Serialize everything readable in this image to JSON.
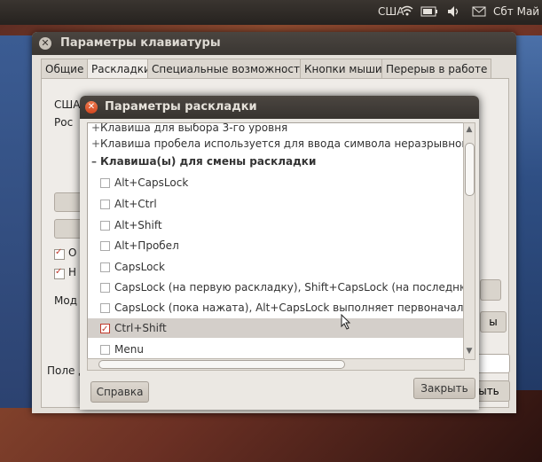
{
  "panel": {
    "layout_indicator": "США",
    "datetime": "Сбт Май",
    "icons": [
      "wifi-icon",
      "battery-icon",
      "volume-icon",
      "mail-icon"
    ]
  },
  "main_window": {
    "title": "Параметры клавиатуры",
    "tabs": [
      {
        "label": "Общие",
        "active": false
      },
      {
        "label": "Раскладки",
        "active": true
      },
      {
        "label": "Специальные возможности",
        "active": false
      },
      {
        "label": "Кнопки мыши",
        "active": false
      },
      {
        "label": "Перерыв в работе",
        "active": false
      }
    ],
    "partial": {
      "list_line1": "США",
      "list_line2": "Рос",
      "check1": "О",
      "check2": "Н",
      "model_label": "Мод",
      "field_label": "Поле д",
      "right_btn": "ы",
      "close_btn_partial": "ыть"
    }
  },
  "dialog": {
    "title": "Параметры раскладки",
    "rows": [
      {
        "type": "group",
        "expander": "+",
        "label": "Клавиша для выбора 3-го уровня"
      },
      {
        "type": "group",
        "expander": "+",
        "label": "Клавиша пробела используется для ввода символа неразрывного пр"
      },
      {
        "type": "group-open",
        "expander": "–",
        "label": "Клавиша(ы) для смены раскладки"
      },
      {
        "type": "option",
        "checked": false,
        "label": "Alt+CapsLock"
      },
      {
        "type": "option",
        "checked": false,
        "label": "Alt+Ctrl"
      },
      {
        "type": "option",
        "checked": false,
        "label": "Alt+Shift"
      },
      {
        "type": "option",
        "checked": false,
        "label": "Alt+Пробел"
      },
      {
        "type": "option",
        "checked": false,
        "label": "CapsLock"
      },
      {
        "type": "option",
        "checked": false,
        "label": "CapsLock (на первую раскладку), Shift+CapsLock (на последнюю рас"
      },
      {
        "type": "option",
        "checked": false,
        "label": "CapsLock (пока нажата), Alt+CapsLock выполняет первоначальную"
      },
      {
        "type": "option",
        "checked": true,
        "label": "Ctrl+Shift"
      },
      {
        "type": "option",
        "checked": false,
        "label": "Menu"
      }
    ],
    "help_button": "Справка",
    "close_button": "Закрыть",
    "scrollbar_position": 0.1
  },
  "colors": {
    "accent_close": "#d2461f",
    "check_red": "#c0392b"
  }
}
